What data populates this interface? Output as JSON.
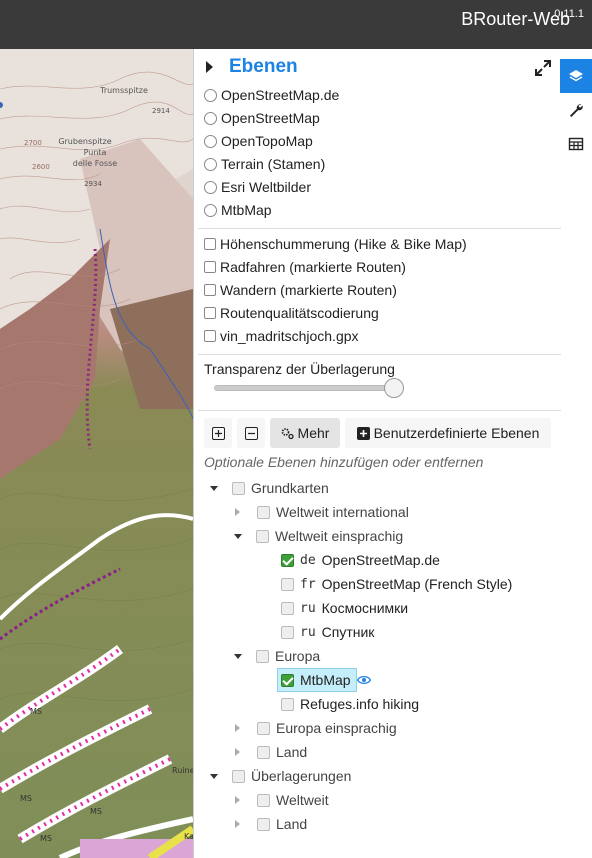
{
  "app": {
    "title": "BRouter-Web",
    "version": "0.11.1"
  },
  "colors": {
    "accent": "#1c83e4",
    "topbar": "#3a3a3a",
    "checked": "#3fa03b"
  },
  "map": {
    "labels": [
      "Trumsspitze",
      "2914",
      "Grubenspitze",
      "Punta",
      "delle Fosse",
      "2934",
      "2700",
      "2600",
      "MS",
      "MS",
      "MS",
      "Ruine",
      "MS",
      "Ka"
    ]
  },
  "sidebar": {
    "title": "Ebenen",
    "tabs": [
      "layers-icon",
      "wrench-icon",
      "table-icon"
    ],
    "base_layers": [
      "OpenStreetMap.de",
      "OpenStreetMap",
      "OpenTopoMap",
      "Terrain (Stamen)",
      "Esri Weltbilder",
      "MtbMap"
    ],
    "overlays": [
      "Höhenschummerung (Hike & Bike Map)",
      "Radfahren (markierte Routen)",
      "Wandern (markierte Routen)",
      "Routenqualitätscodierung",
      "vin_madritschjoch.gpx"
    ],
    "opacity": {
      "label": "Transparenz der Überlagerung",
      "value": 0.95
    },
    "buttons": {
      "more": "Mehr",
      "custom": "Benutzerdefinierte Ebenen"
    },
    "hint": "Optionale Ebenen hinzufügen oder entfernen",
    "tree": {
      "grundkarten": "Grundkarten",
      "weltweit_international": "Weltweit international",
      "weltweit_einsprachig": "Weltweit einsprachig",
      "items_einsprachig": [
        {
          "code": "de",
          "label": "OpenStreetMap.de",
          "checked": true
        },
        {
          "code": "fr",
          "label": "OpenStreetMap (French Style)",
          "checked": false
        },
        {
          "code": "ru",
          "label": "Космоснимки",
          "checked": false
        },
        {
          "code": "ru",
          "label": "Спутник",
          "checked": false
        }
      ],
      "europa": "Europa",
      "europa_items": [
        {
          "label": "MtbMap",
          "checked": true
        },
        {
          "label": "Refuges.info hiking",
          "checked": false
        }
      ],
      "europa_einsprachig": "Europa einsprachig",
      "land": "Land",
      "ueberlagerungen": "Überlagerungen",
      "overlay_weltweit": "Weltweit",
      "overlay_land": "Land"
    }
  }
}
